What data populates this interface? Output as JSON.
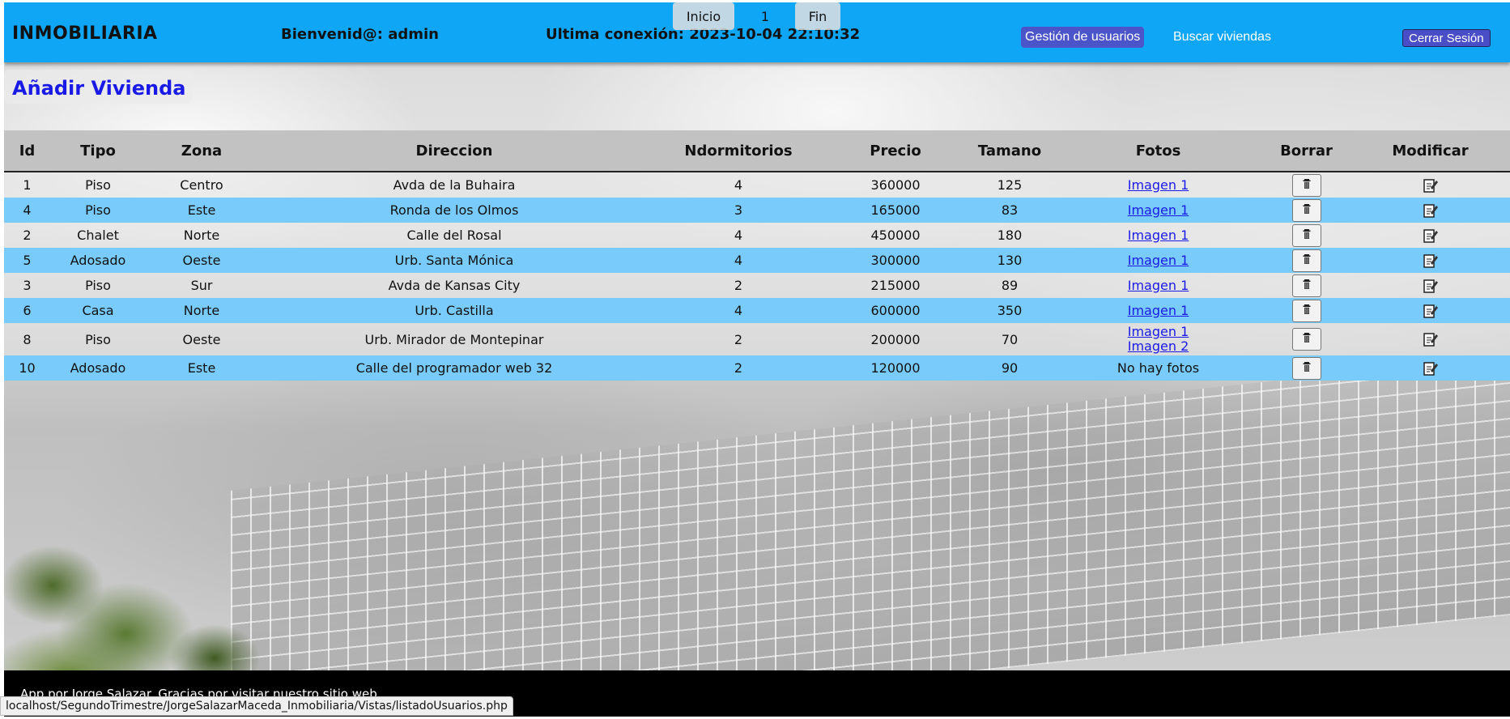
{
  "header": {
    "brand": "INMOBILIARIA",
    "welcome": "Bienvenid@: admin",
    "last_connection": "Ultima conexión: 2023-10-04 22:10:32",
    "nav_users": "Gestión de usuarios",
    "nav_search": "Buscar viviendas",
    "logout": "Cerrar Sesión"
  },
  "actions": {
    "add": "Añadir Vivienda"
  },
  "table": {
    "columns": [
      "Id",
      "Tipo",
      "Zona",
      "Direccion",
      "Ndormitorios",
      "Precio",
      "Tamano",
      "Fotos",
      "Borrar",
      "Modificar"
    ],
    "rows": [
      {
        "id": "1",
        "tipo": "Piso",
        "zona": "Centro",
        "direccion": "Avda de la Buhaira",
        "ndorm": "4",
        "precio": "360000",
        "tamano": "125",
        "fotos": [
          "Imagen 1"
        ]
      },
      {
        "id": "4",
        "tipo": "Piso",
        "zona": "Este",
        "direccion": "Ronda de los Olmos",
        "ndorm": "3",
        "precio": "165000",
        "tamano": "83",
        "fotos": [
          "Imagen 1"
        ]
      },
      {
        "id": "2",
        "tipo": "Chalet",
        "zona": "Norte",
        "direccion": "Calle del Rosal",
        "ndorm": "4",
        "precio": "450000",
        "tamano": "180",
        "fotos": [
          "Imagen 1"
        ]
      },
      {
        "id": "5",
        "tipo": "Adosado",
        "zona": "Oeste",
        "direccion": "Urb. Santa Mónica",
        "ndorm": "4",
        "precio": "300000",
        "tamano": "130",
        "fotos": [
          "Imagen 1"
        ]
      },
      {
        "id": "3",
        "tipo": "Piso",
        "zona": "Sur",
        "direccion": "Avda de Kansas City",
        "ndorm": "2",
        "precio": "215000",
        "tamano": "89",
        "fotos": [
          "Imagen 1"
        ]
      },
      {
        "id": "6",
        "tipo": "Casa",
        "zona": "Norte",
        "direccion": "Urb. Castilla",
        "ndorm": "4",
        "precio": "600000",
        "tamano": "350",
        "fotos": [
          "Imagen 1"
        ]
      },
      {
        "id": "8",
        "tipo": "Piso",
        "zona": "Oeste",
        "direccion": "Urb. Mirador de Montepinar",
        "ndorm": "2",
        "precio": "200000",
        "tamano": "70",
        "fotos": [
          "Imagen 1",
          "Imagen 2"
        ]
      },
      {
        "id": "10",
        "tipo": "Adosado",
        "zona": "Este",
        "direccion": "Calle del programador web 32",
        "ndorm": "2",
        "precio": "120000",
        "tamano": "90",
        "fotos": [],
        "fotos_empty": "No hay fotos"
      }
    ]
  },
  "pagination": {
    "first": "Inicio",
    "page": "1",
    "last": "Fin"
  },
  "footer": {
    "text": "App por Jorge Salazar. Gracias por visitar nuestro sitio web."
  },
  "status_bar": {
    "url": "localhost/SegundoTrimestre/JorgeSalazarMaceda_Inmobiliaria/Vistas/listadoUsuarios.php"
  }
}
